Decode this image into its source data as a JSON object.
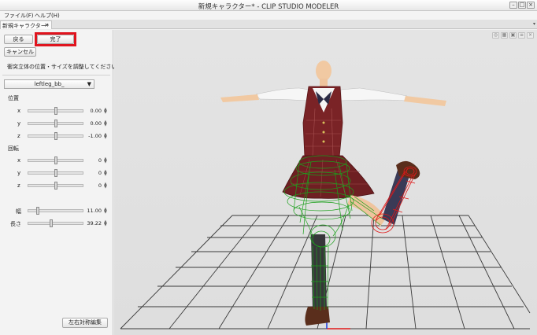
{
  "window": {
    "title": "新規キャラクター* - CLIP STUDIO MODELER"
  },
  "menu": {
    "items": [
      "ファイル(F)",
      "ヘルプ(H)"
    ]
  },
  "tab": {
    "label": "新規キャラクター*",
    "close": "×"
  },
  "panel": {
    "back_label": "戻る",
    "done_label": "完了",
    "cancel_label": "キャンセル",
    "hint": "衝突立体の位置・サイズを調整してください。",
    "bone": "leftleg_bb_",
    "position_label": "位置",
    "rotation_label": "回転",
    "position": [
      {
        "axis": "x",
        "value": "0.00"
      },
      {
        "axis": "y",
        "value": "0.00"
      },
      {
        "axis": "z",
        "value": "-1.00"
      }
    ],
    "rotation": [
      {
        "axis": "x",
        "value": "0"
      },
      {
        "axis": "y",
        "value": "0"
      },
      {
        "axis": "z",
        "value": "0"
      }
    ],
    "width": {
      "label": "幅",
      "value": "11.00"
    },
    "length": {
      "label": "長さ",
      "value": "39.22"
    },
    "symmetry_label": "左右対称編集"
  },
  "colors": {
    "highlight": "#e0141e",
    "wire_green": "#1ca01c",
    "wire_red": "#e01818",
    "uniform_red": "#7a2326"
  }
}
